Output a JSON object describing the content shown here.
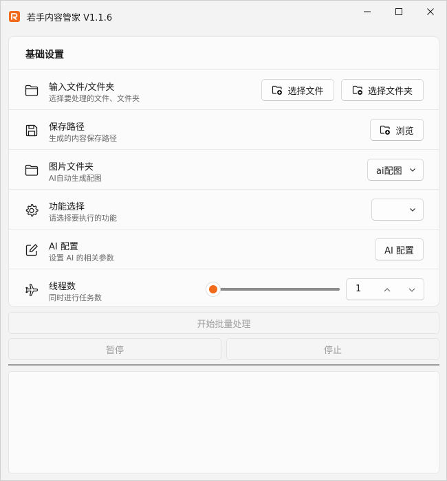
{
  "window": {
    "title": "若手内容管家 V1.1.6",
    "accent": "#f26b1d"
  },
  "settings": {
    "heading": "基础设置",
    "rows": [
      {
        "icon": "folder-icon",
        "title": "输入文件/文件夹",
        "subtitle": "选择要处理的文件、文件夹",
        "buttons": [
          {
            "icon": "folder-add-icon",
            "label": "选择文件"
          },
          {
            "icon": "folder-add-icon",
            "label": "选择文件夹"
          }
        ]
      },
      {
        "icon": "save-icon",
        "title": "保存路径",
        "subtitle": "生成的内容保存路径",
        "buttons": [
          {
            "icon": "folder-add-icon",
            "label": "浏览"
          }
        ]
      },
      {
        "icon": "folder-icon",
        "title": "图片文件夹",
        "subtitle": "AI自动生成配图",
        "dropdown": {
          "selected": "ai配图"
        }
      },
      {
        "icon": "gear-icon",
        "title": "功能选择",
        "subtitle": "请选择要执行的功能",
        "dropdown": {
          "selected": ""
        }
      },
      {
        "icon": "edit-icon",
        "title": "AI 配置",
        "subtitle": "设置 AI 的相关参数",
        "buttons": [
          {
            "label": "AI 配置"
          }
        ]
      },
      {
        "icon": "airplane-icon",
        "title": "线程数",
        "subtitle": "同时进行任务数",
        "slider": {
          "fraction": 0.0
        },
        "spinbox": {
          "value": "1"
        }
      }
    ]
  },
  "actions": {
    "start": "开始批量处理",
    "pause": "暂停",
    "stop": "停止"
  },
  "log": {
    "text": ""
  }
}
